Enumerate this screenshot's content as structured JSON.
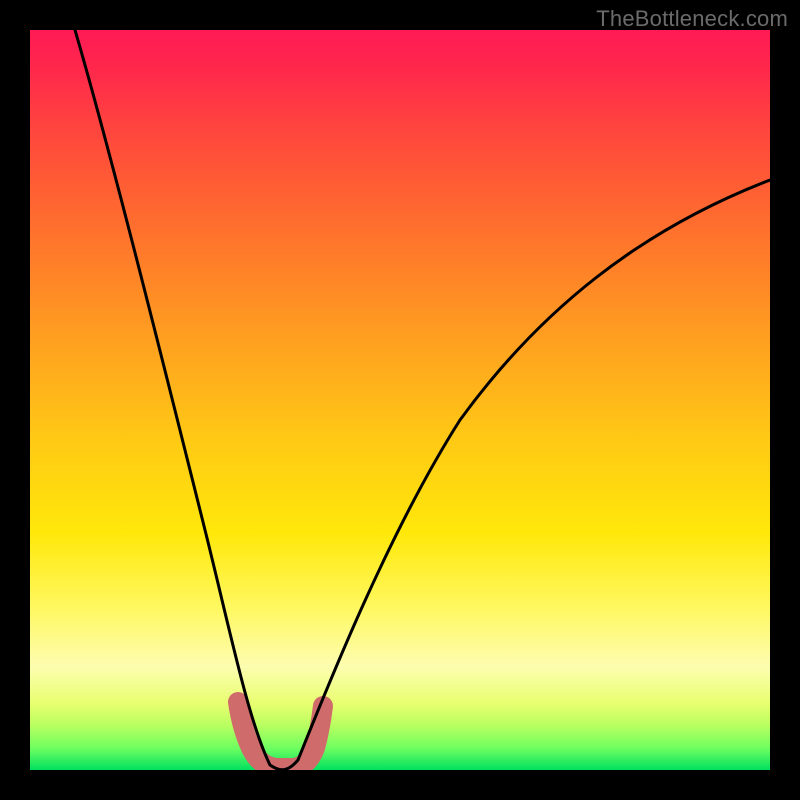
{
  "watermark": "TheBottleneck.com",
  "chart_data": {
    "type": "line",
    "title": "",
    "xlabel": "",
    "ylabel": "",
    "xlim": [
      0,
      100
    ],
    "ylim": [
      0,
      100
    ],
    "series": [
      {
        "name": "bottleneck-curve",
        "x": [
          0,
          4,
          8,
          12,
          16,
          20,
          24,
          27,
          29,
          31,
          33,
          35,
          37,
          40,
          44,
          50,
          58,
          68,
          80,
          92,
          100
        ],
        "values": [
          100,
          88,
          76,
          63,
          50,
          37,
          24,
          12,
          5,
          1,
          0,
          1,
          4,
          10,
          20,
          33,
          47,
          59,
          69,
          76,
          80
        ]
      }
    ],
    "annotation": {
      "name": "optimal-range-marker",
      "x_range": [
        28,
        38
      ],
      "y_range": [
        0,
        9
      ],
      "color": "#cf6b6b"
    },
    "background_gradient": {
      "top_color": "#ff1a55",
      "bottom_color": "#00e060",
      "meaning": "red-high-bottleneck green-low-bottleneck"
    }
  }
}
